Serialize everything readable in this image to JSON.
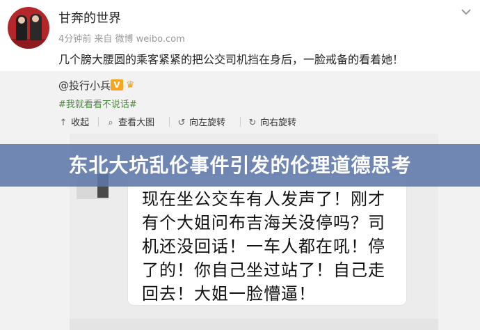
{
  "post": {
    "username": "甘奔的世界",
    "meta": "4分钟前 来自 微博 weibo.com",
    "text": "几个膀大腰圆的乘客紧紧的把公交司机挡在身后，一脸戒备的看着她！"
  },
  "repost": {
    "at_user": "@投行小兵",
    "vbadge": "V",
    "hashtag": "#我就看看不说话#",
    "toolbar": [
      {
        "icon": "collapse-icon",
        "glyph": "↑",
        "label": "收起"
      },
      {
        "icon": "search-icon",
        "glyph": "⌕",
        "label": "查看大图"
      },
      {
        "icon": "rotate-left-icon",
        "glyph": "↺",
        "label": "向左旋转"
      },
      {
        "icon": "rotate-right-icon",
        "glyph": "↻",
        "label": "向右旋转"
      }
    ]
  },
  "bubble": {
    "lines": [
      "现在坐公交车有人发声了！刚才",
      "有个大姐问布吉海关没停吗？司",
      "机还没回话！一车人都在吼！停",
      "了的！你自己坐过站了！自己走",
      "回去！大姐一脸懵逼！"
    ]
  },
  "banner": {
    "headline": "东北大坑乱伦事件引发的伦理道德思考"
  },
  "colors": {
    "banner_bg": "#5f78aa",
    "hashtag": "#4a8a3c",
    "badge": "#f5a623"
  }
}
